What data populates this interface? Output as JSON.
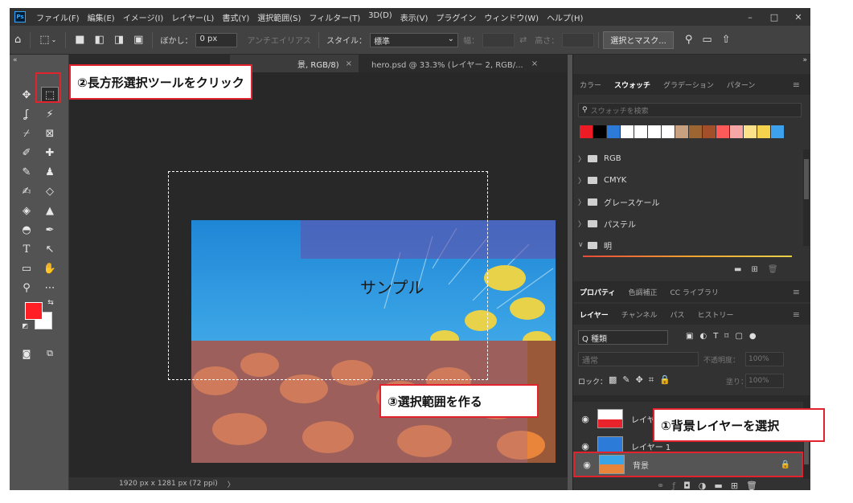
{
  "menubar": {
    "logo": "Ps",
    "items": [
      "ファイル(F)",
      "編集(E)",
      "イメージ(I)",
      "レイヤー(L)",
      "書式(Y)",
      "選択範囲(S)",
      "フィルター(T)",
      "3D(D)",
      "表示(V)",
      "プラグイン",
      "ウィンドウ(W)",
      "ヘルプ(H)"
    ],
    "minimize": "–",
    "maximize": "□",
    "close": "✕"
  },
  "options": {
    "blur_label": "ぼかし：",
    "blur_value": "0 px",
    "antialias_label": "アンチエイリアス",
    "style_label": "スタイル：",
    "style_value": "標準",
    "width_label": "幅：",
    "height_label": "高さ：",
    "select_mask_button": "選択とマスク..."
  },
  "tabs": {
    "active_suffix": "景, RGB/8)",
    "active_close": "×",
    "second": "hero.psd @ 33.3% (レイヤー 2, RGB/...",
    "second_close": "×"
  },
  "canvas": {
    "sample_text": "サンプル"
  },
  "status": {
    "dimensions": "1920 px x 1281 px (72 ppi)",
    "arrow": "〉"
  },
  "swatch_panel": {
    "tabs": [
      "カラー",
      "スウォッチ",
      "グラデーション",
      "パターン"
    ],
    "active_tab": 1,
    "search_placeholder": "スウォッチを検索",
    "colors": [
      "#ed1c24",
      "#000000",
      "#2d7bd8",
      "#ffffff",
      "#ffffff",
      "#ffffff",
      "#ffffff",
      "#c7a180",
      "#9c6531",
      "#a24f2a",
      "#ff5a5a",
      "#f7a6a6",
      "#fbe28a",
      "#f5d34d",
      "#3ea1ee"
    ],
    "folders": [
      {
        "chevron": "〉",
        "name": "RGB"
      },
      {
        "chevron": "〉",
        "name": "CMYK"
      },
      {
        "chevron": "〉",
        "name": "グレースケール"
      },
      {
        "chevron": "〉",
        "name": "パステル"
      },
      {
        "chevron": "∨",
        "name": "明"
      }
    ]
  },
  "properties_panel": {
    "tabs": [
      "プロパティ",
      "色調補正",
      "CC ライブラリ"
    ]
  },
  "layers_panel": {
    "tabs": [
      "レイヤー",
      "チャンネル",
      "パス",
      "ヒストリー"
    ],
    "filter_kind": "Q 種類",
    "blend_mode": "通常",
    "opacity_label": "不透明度：",
    "opacity_value": "100%",
    "lock_label": "ロック：",
    "fill_label": "塗り：",
    "fill_value": "100%",
    "layers": [
      {
        "name": "レイヤー 2",
        "visible": true
      },
      {
        "name": "レイヤー 1",
        "visible": true
      },
      {
        "name": "背景",
        "visible": true,
        "locked": true
      }
    ]
  },
  "annotations": {
    "step1": "①背景レイヤーを選択",
    "step2": "②長方形選択ツールをクリック",
    "step3": "③選択範囲を作る"
  },
  "colors": {
    "foreground": "#ff1f25",
    "background": "#ffffff",
    "annotation_red": "#e0232c"
  }
}
